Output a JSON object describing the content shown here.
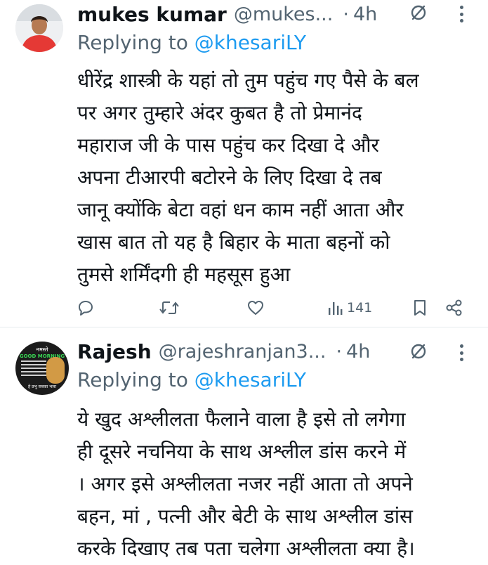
{
  "tweets": [
    {
      "name": "mukes kumar",
      "handle": "@mukes...",
      "dot": "·",
      "time": "4h",
      "replying_prefix": "Replying to",
      "replying_handle": "@khesariLY",
      "lines": [
        "धीरेंद्र शास्त्री के यहां तो तुम पहुंच गए पैसे के बल",
        "पर अगर तुम्हारे अंदर कुबत है तो प्रेमानंद",
        "महाराज जी के पास पहुंच कर दिखा दे और",
        "अपना टीआरपी बटोरने के लिए दिखा दे तब",
        "जानू क्योंकि बेटा वहां धन काम नहीं आता और",
        "खास बात तो यह है बिहार के माता बहनों को",
        "तुमसे शर्मिंदगी ही महसूस हुआ"
      ],
      "views": "141"
    },
    {
      "name": "Rajesh",
      "handle": "@rajeshranjan3...",
      "dot": "·",
      "time": "4h",
      "replying_prefix": "Replying to",
      "replying_handle": "@khesariLY",
      "lines": [
        "ये खुद अश्लीलता फैलाने वाला है इसे तो लगेगा",
        "ही दूसरे नचनिया के साथ अश्लील डांस करने में",
        "। अगर इसे अश्लीलता नजर नहीं आता तो अपने",
        "बहन, मां , पत्नी और बेटी के साथ अश्लील डांस",
        "करके दिखाए तब पता चलेगा अश्लीलता क्या है।"
      ],
      "avatar_text": {
        "top": "नमस्ते",
        "greeting": "GOOD MORNING",
        "bottom": "हे प्रभु सबका भला"
      }
    }
  ],
  "icons": {
    "reply": "reply-icon",
    "retweet": "retweet-icon",
    "like": "heart-icon",
    "views": "views-icon",
    "bookmark": "bookmark-icon",
    "share": "share-icon",
    "grok": "grok-icon",
    "more": "more-icon"
  },
  "colors": {
    "text": "#0f1419",
    "secondary": "#536471",
    "link": "#1d9bf0",
    "divider": "#e6ebee"
  }
}
